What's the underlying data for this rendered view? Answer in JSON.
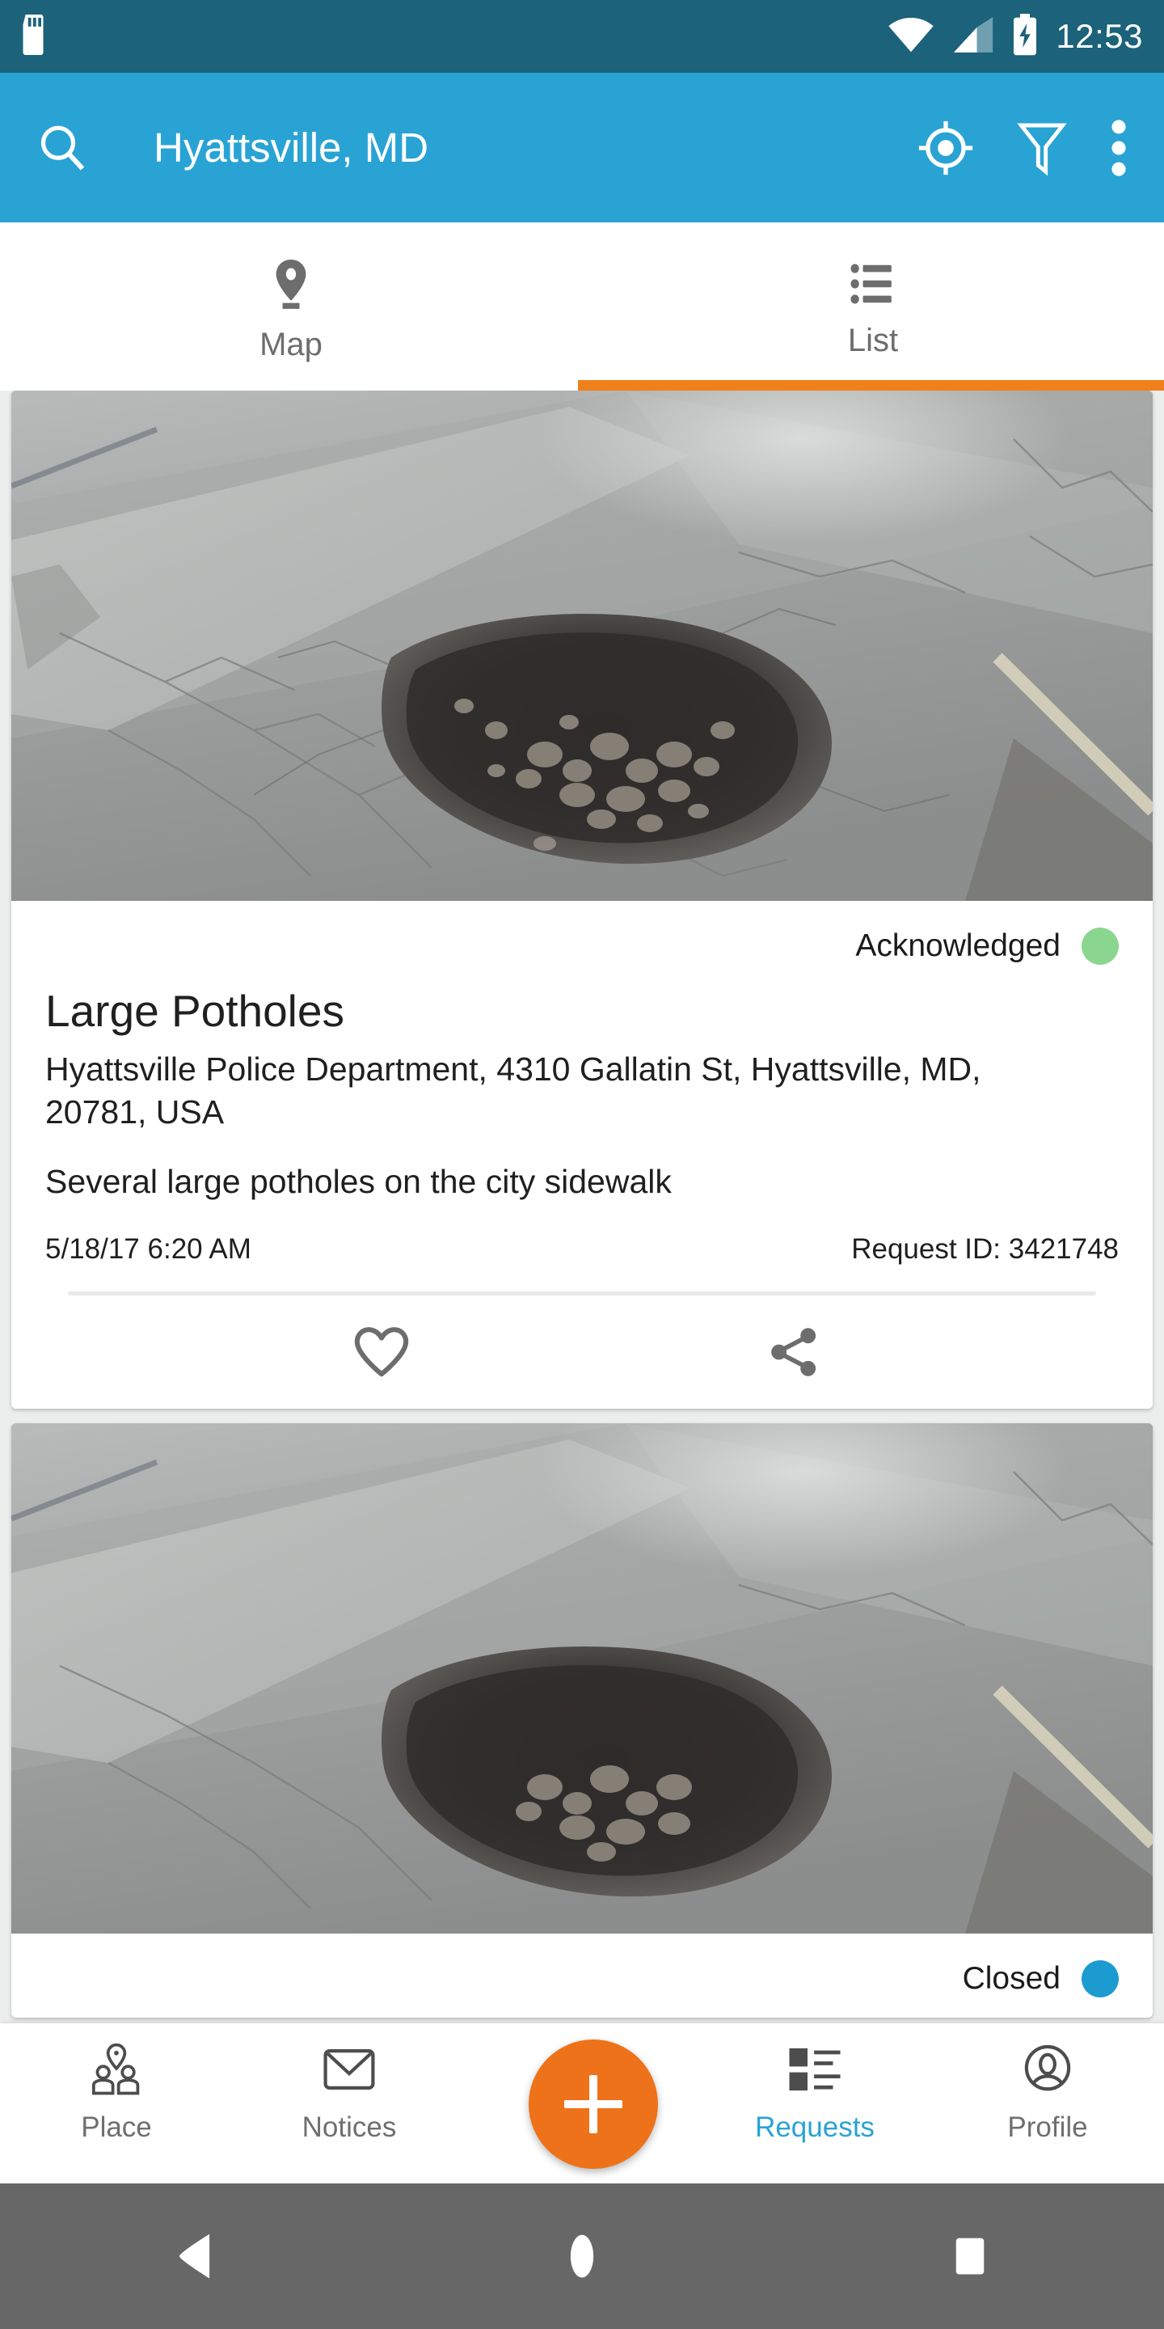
{
  "status_bar": {
    "time": "12:53",
    "icons": [
      "sd-card-icon",
      "wifi-icon",
      "cellular-signal-icon",
      "battery-charging-icon"
    ]
  },
  "app_bar": {
    "title": "Hyattsville, MD",
    "background_color": "#29a3d4",
    "search_icon": "search-icon",
    "my_location_icon": "my-location-icon",
    "filter_icon": "filter-icon",
    "overflow_icon": "overflow-menu-icon"
  },
  "tabs": {
    "active_index": 1,
    "indicator_color": "#f08019",
    "items": [
      {
        "label": "Map",
        "icon": "map-pin-icon"
      },
      {
        "label": "List",
        "icon": "list-icon"
      }
    ]
  },
  "requests": [
    {
      "status": "Acknowledged",
      "status_color": "#8bd68f",
      "title": "Large Potholes",
      "address": "Hyattsville Police Department, 4310 Gallatin St, Hyattsville, MD, 20781, USA",
      "description": "Several large potholes on the city sidewalk",
      "timestamp": "5/18/17 6:20 AM",
      "request_id": "Request ID: 3421748",
      "favorite_icon": "heart-icon",
      "share_icon": "share-icon",
      "photo_alt": "pothole-photo"
    },
    {
      "status": "Closed",
      "status_color": "#1b9bd0",
      "photo_alt": "pothole-photo"
    }
  ],
  "bottom_nav": {
    "active_label": "Requests",
    "active_color": "#29a3d4",
    "fab": {
      "icon": "plus-icon",
      "color": "#ee7219"
    },
    "items": [
      {
        "label": "Place",
        "icon": "people-place-icon"
      },
      {
        "label": "Notices",
        "icon": "envelope-icon"
      },
      {
        "label": "Requests",
        "icon": "requests-list-icon"
      },
      {
        "label": "Profile",
        "icon": "account-circle-icon"
      }
    ]
  },
  "system_nav": {
    "back": "back-triangle-icon",
    "home": "home-circle-icon",
    "recents": "recents-square-icon"
  }
}
